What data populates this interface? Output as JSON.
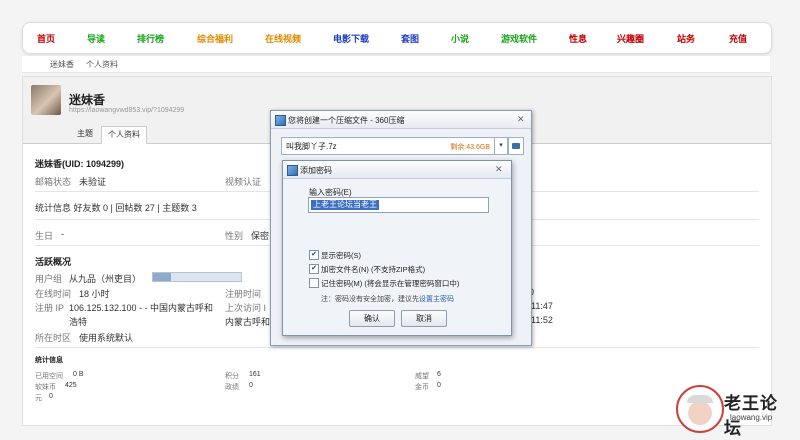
{
  "nav": {
    "items": [
      {
        "label": "首页",
        "color": "#c00000"
      },
      {
        "label": "导读",
        "color": "#1aa31a"
      },
      {
        "label": "排行榜",
        "color": "#1aa31a"
      },
      {
        "label": "综合福利",
        "color": "#e08a00"
      },
      {
        "label": "在线视频",
        "color": "#e08a00"
      },
      {
        "label": "电影下载",
        "color": "#1f3fbf"
      },
      {
        "label": "套图",
        "color": "#1f3fbf"
      },
      {
        "label": "小说",
        "color": "#1aa31a"
      },
      {
        "label": "游戏软件",
        "color": "#1aa31a"
      },
      {
        "label": "性息",
        "color": "#c00000"
      },
      {
        "label": "兴趣圈",
        "color": "#c00000"
      },
      {
        "label": "站务",
        "color": "#c00000"
      },
      {
        "label": "充值",
        "color": "#c00000"
      }
    ]
  },
  "breadcrumb": {
    "home": "迷妹香",
    "current": "个人资料"
  },
  "profile": {
    "name": "迷妹香",
    "url": "https://laowangvwd853.vip/?1094299",
    "tabs": [
      "主题",
      "个人资料"
    ],
    "uid_line": "迷妹香(UID: 1094299)",
    "email_label": "邮箱状态",
    "email_value": "未验证",
    "video_label": "视频认证",
    "stats_line": "统计信息 好友数 0 | 回帖数 27 | 主题数 3",
    "birthday_label": "生日",
    "birthday_value": "-",
    "gender_label": "性别",
    "gender_value": "保密"
  },
  "activity": {
    "title": "活跃概况",
    "group_label": "用户组",
    "group_value": "从九品（州吏目）",
    "group_progress": 0.2,
    "online_label": "在线时间",
    "online_value": "18 小时",
    "reg_time_label": "注册时间",
    "reg_ip_label": "注册 IP",
    "reg_ip_value": "106.125.132.100 - - 中国内蒙古呼和浩特",
    "last_visit_label": "上次访问 I",
    "last_visit_partial": "内蒙古呼和",
    "tz_label": "所在时区",
    "tz_value": "使用系统默认",
    "right_digit": "1",
    "right_zero": "0",
    "time1": "11:47",
    "time2": "11:52"
  },
  "stats": {
    "title": "统计信息",
    "items": [
      {
        "label": "已用空间",
        "value": "0 B"
      },
      {
        "label": "积分",
        "value": "161"
      },
      {
        "label": "威望",
        "value": "6"
      },
      {
        "label": "软妹币",
        "value": "425"
      },
      {
        "label": "政绩",
        "value": "0"
      },
      {
        "label": "金币",
        "value": "0"
      },
      {
        "label": "元",
        "value": "0"
      }
    ]
  },
  "compress_dialog": {
    "title": "您将创建一个压缩文件 - 360压缩",
    "path": "叫我脚丫子.7z",
    "free_space": "剩余:43.6GB"
  },
  "password_dialog": {
    "title": "添加密码",
    "input_label": "输入密码(E)",
    "password_value": "上老王论坛当老王",
    "show_password": "显示密码(S)",
    "show_password_checked": true,
    "encrypt_names": "加密文件名(N) (不支持ZIP格式)",
    "encrypt_names_checked": true,
    "remember": "记住密码(M) (将会显示在管理密码窗口中)",
    "remember_checked": false,
    "note": "注：密码没有安全加密，建议先",
    "note_link": "设置主密码",
    "ok": "确认",
    "cancel": "取消"
  },
  "watermark": {
    "title": "老王论坛",
    "sub": "laowang.vip"
  }
}
